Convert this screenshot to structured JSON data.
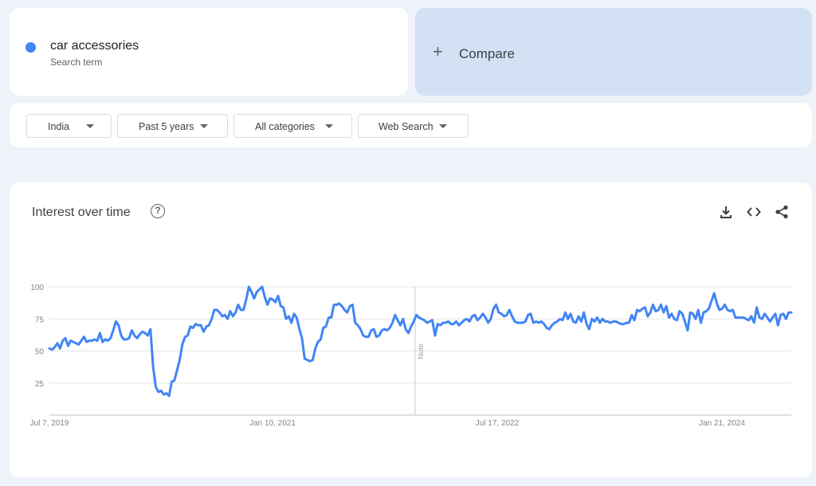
{
  "search_term": {
    "name": "car accessories",
    "subtitle": "Search term",
    "color": "#4285f4"
  },
  "compare": {
    "label": "Compare"
  },
  "filters": [
    {
      "label": "India"
    },
    {
      "label": "Past 5 years"
    },
    {
      "label": "All categories"
    },
    {
      "label": "Web Search"
    }
  ],
  "panel": {
    "title": "Interest over time",
    "help_icon": "help-circle-icon",
    "toolbar": [
      "download-icon",
      "embed-code-icon",
      "share-icon"
    ]
  },
  "chart_data": {
    "type": "line",
    "title": "Interest over time",
    "xlabel": "",
    "ylabel": "",
    "ylim": [
      0,
      100
    ],
    "grid": true,
    "legend": "none",
    "color": "#4285f4",
    "y_ticks": [
      25,
      50,
      75,
      100
    ],
    "x_ticks": [
      "Jul 7, 2019",
      "Jan 10, 2021",
      "Jul 17, 2022",
      "Jan 21, 2024"
    ],
    "note": {
      "label": "Note",
      "x": "Jan 2022"
    },
    "series": [
      {
        "name": "car accessories",
        "values": [
          52,
          51,
          53,
          56,
          52,
          58,
          60,
          54,
          58,
          57,
          56,
          55,
          58,
          61,
          57,
          58,
          58,
          59,
          58,
          64,
          57,
          59,
          58,
          60,
          66,
          73,
          70,
          62,
          59,
          59,
          60,
          66,
          62,
          60,
          63,
          65,
          64,
          62,
          67,
          38,
          22,
          18,
          19,
          16,
          17,
          15,
          26,
          27,
          35,
          43,
          55,
          61,
          62,
          69,
          68,
          71,
          70,
          70,
          65,
          69,
          70,
          75,
          82,
          82,
          80,
          77,
          78,
          75,
          81,
          77,
          80,
          86,
          82,
          82,
          90,
          100,
          96,
          91,
          96,
          98,
          100,
          92,
          86,
          91,
          90,
          88,
          93,
          85,
          84,
          75,
          77,
          72,
          79,
          76,
          67,
          60,
          44,
          43,
          42,
          43,
          52,
          57,
          59,
          68,
          69,
          76,
          76,
          86,
          86,
          87,
          85,
          82,
          80,
          85,
          86,
          72,
          70,
          67,
          62,
          61,
          61,
          66,
          67,
          61,
          62,
          66,
          67,
          66,
          68,
          72,
          78,
          74,
          70,
          75,
          67,
          64,
          69,
          73,
          78,
          76,
          75,
          74,
          72,
          73,
          74,
          62,
          71,
          70,
          72,
          72,
          73,
          71,
          71,
          73,
          70,
          72,
          74,
          75,
          73,
          77,
          78,
          74,
          76,
          79,
          76,
          72,
          75,
          83,
          86,
          80,
          79,
          77,
          78,
          82,
          77,
          73,
          72,
          72,
          72,
          73,
          78,
          79,
          72,
          73,
          72,
          73,
          71,
          68,
          67,
          70,
          72,
          73,
          75,
          74,
          80,
          75,
          79,
          73,
          72,
          77,
          73,
          80,
          71,
          67,
          75,
          73,
          76,
          72,
          75,
          73,
          73,
          72,
          73,
          73,
          72,
          71,
          71,
          72,
          72,
          78,
          74,
          82,
          81,
          83,
          84,
          77,
          80,
          86,
          81,
          82,
          86,
          80,
          85,
          76,
          79,
          75,
          74,
          81,
          79,
          73,
          66,
          80,
          79,
          75,
          82,
          72,
          80,
          81,
          83,
          89,
          95,
          87,
          82,
          83,
          86,
          82,
          81,
          82,
          76,
          76,
          76,
          76,
          75,
          74,
          77,
          72,
          84,
          76,
          75,
          79,
          76,
          73,
          76,
          79,
          70,
          78,
          79,
          75,
          80,
          80
        ]
      }
    ]
  }
}
